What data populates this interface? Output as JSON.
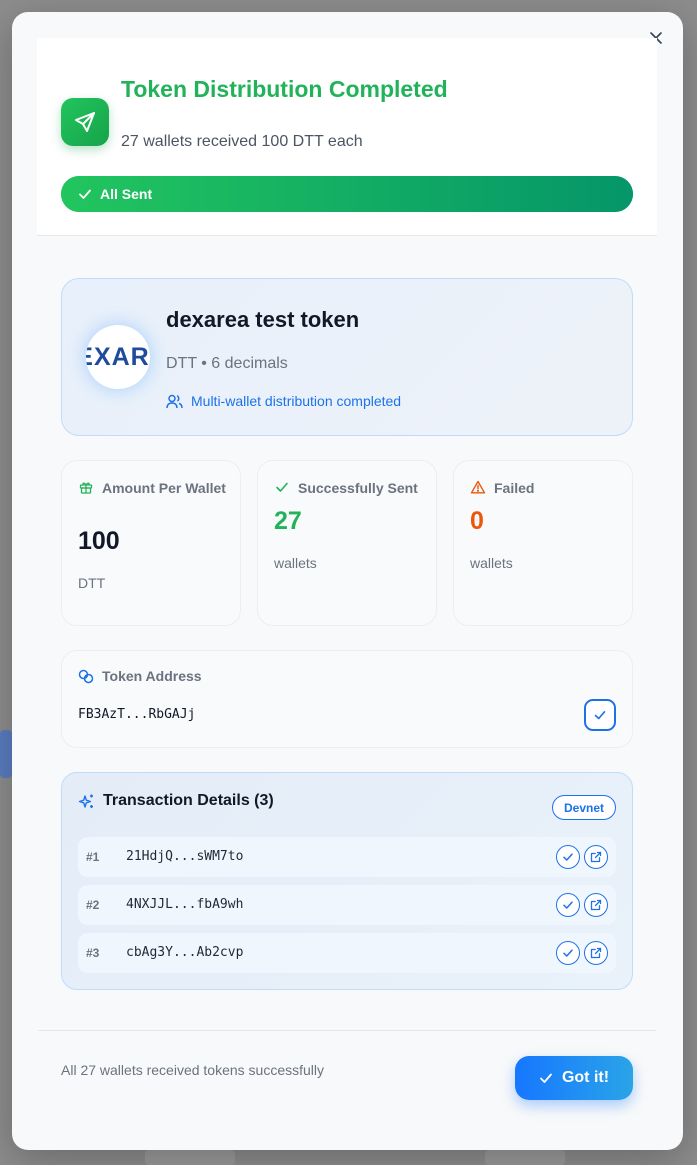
{
  "colors": {
    "success": "#22b35a",
    "primary": "#1d72e8",
    "warning": "#ea580c",
    "muted": "#6b7280"
  },
  "header": {
    "title": "Token Distribution Completed",
    "subtitle": "27 wallets received 100 DTT each",
    "icon": "send-icon",
    "progress_label": "All Sent",
    "progress_fraction": 1.0
  },
  "token": {
    "logo_text": "EXAR",
    "name": "dexarea test token",
    "meta": "DTT • 6 decimals",
    "status": "Multi-wallet distribution completed"
  },
  "stats": {
    "amount": {
      "label": "Amount Per Wallet",
      "value": "100",
      "unit": "DTT",
      "icon": "gift-icon"
    },
    "sent": {
      "label": "Successfully Sent",
      "value": "27",
      "unit": "wallets",
      "icon": "check-icon"
    },
    "failed": {
      "label": "Failed",
      "value": "0",
      "unit": "wallets",
      "icon": "warning-icon"
    }
  },
  "address": {
    "label": "Token Address",
    "value": "FB3AzT...RbGAJj",
    "icon": "link-icon"
  },
  "transactions": {
    "title": "Transaction Details (3)",
    "network": "Devnet",
    "icon": "sparkles-icon",
    "rows": [
      {
        "num": "#1",
        "hash": "21HdjQ...sWM7to"
      },
      {
        "num": "#2",
        "hash": "4NXJJL...fbA9wh"
      },
      {
        "num": "#3",
        "hash": "cbAg3Y...Ab2cvp"
      }
    ]
  },
  "footer": {
    "message": "All 27 wallets received tokens successfully",
    "button": "Got it!"
  }
}
